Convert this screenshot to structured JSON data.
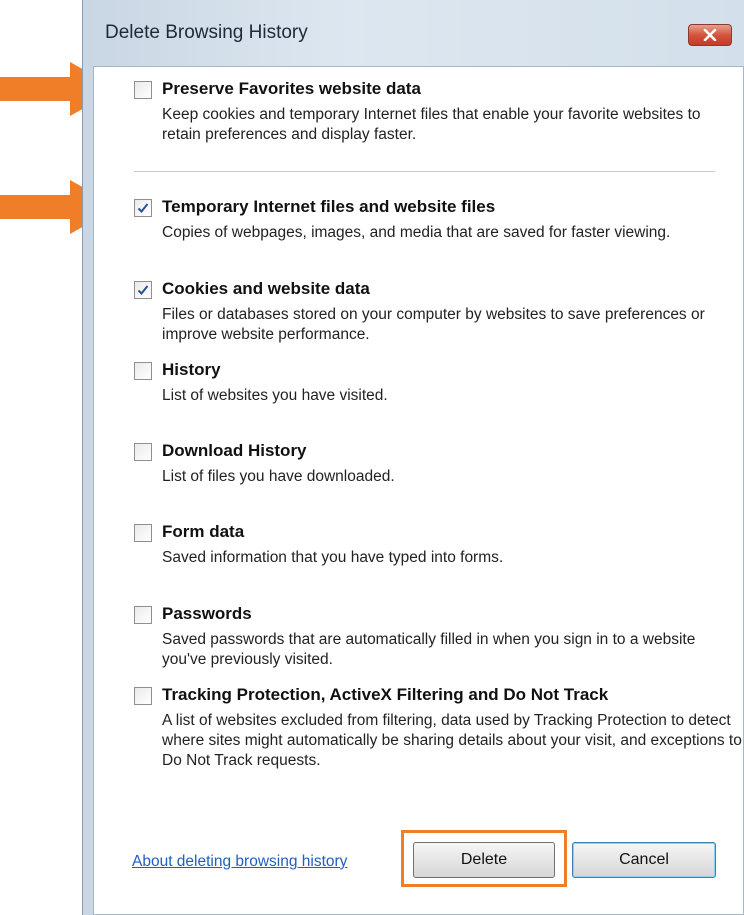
{
  "dialog": {
    "title": "Delete Browsing History",
    "close_icon": "close-x-icon"
  },
  "options": [
    {
      "key": "preserve_favorites",
      "label": "Preserve Favorites website data",
      "desc": "Keep cookies and temporary Internet files that enable your favorite websites to retain preferences and display faster.",
      "checked": false
    },
    {
      "key": "temp_files",
      "label": "Temporary Internet files and website files",
      "desc": "Copies of webpages, images, and media that are saved for faster viewing.",
      "checked": true
    },
    {
      "key": "cookies",
      "label": "Cookies and website data",
      "desc": "Files or databases stored on your computer by websites to save preferences or improve website performance.",
      "checked": true
    },
    {
      "key": "history",
      "label": "History",
      "desc": "List of websites you have visited.",
      "checked": false
    },
    {
      "key": "download_history",
      "label": "Download History",
      "desc": "List of files you have downloaded.",
      "checked": false
    },
    {
      "key": "form_data",
      "label": "Form data",
      "desc": "Saved information that you have typed into forms.",
      "checked": false
    },
    {
      "key": "passwords",
      "label": "Passwords",
      "desc": "Saved passwords that are automatically filled in when you sign in to a website you've previously visited.",
      "checked": false
    },
    {
      "key": "tracking",
      "label": "Tracking Protection, ActiveX Filtering and Do Not Track",
      "desc": "A list of websites excluded from filtering, data used by Tracking Protection to detect where sites might automatically be sharing details about your visit, and exceptions to Do Not Track requests.",
      "checked": false
    }
  ],
  "footer": {
    "link_text": "About deleting browsing history",
    "delete_label": "Delete",
    "cancel_label": "Cancel"
  },
  "annotations": {
    "arrow_color": "#f07d27",
    "highlight_color": "#f07d27"
  }
}
